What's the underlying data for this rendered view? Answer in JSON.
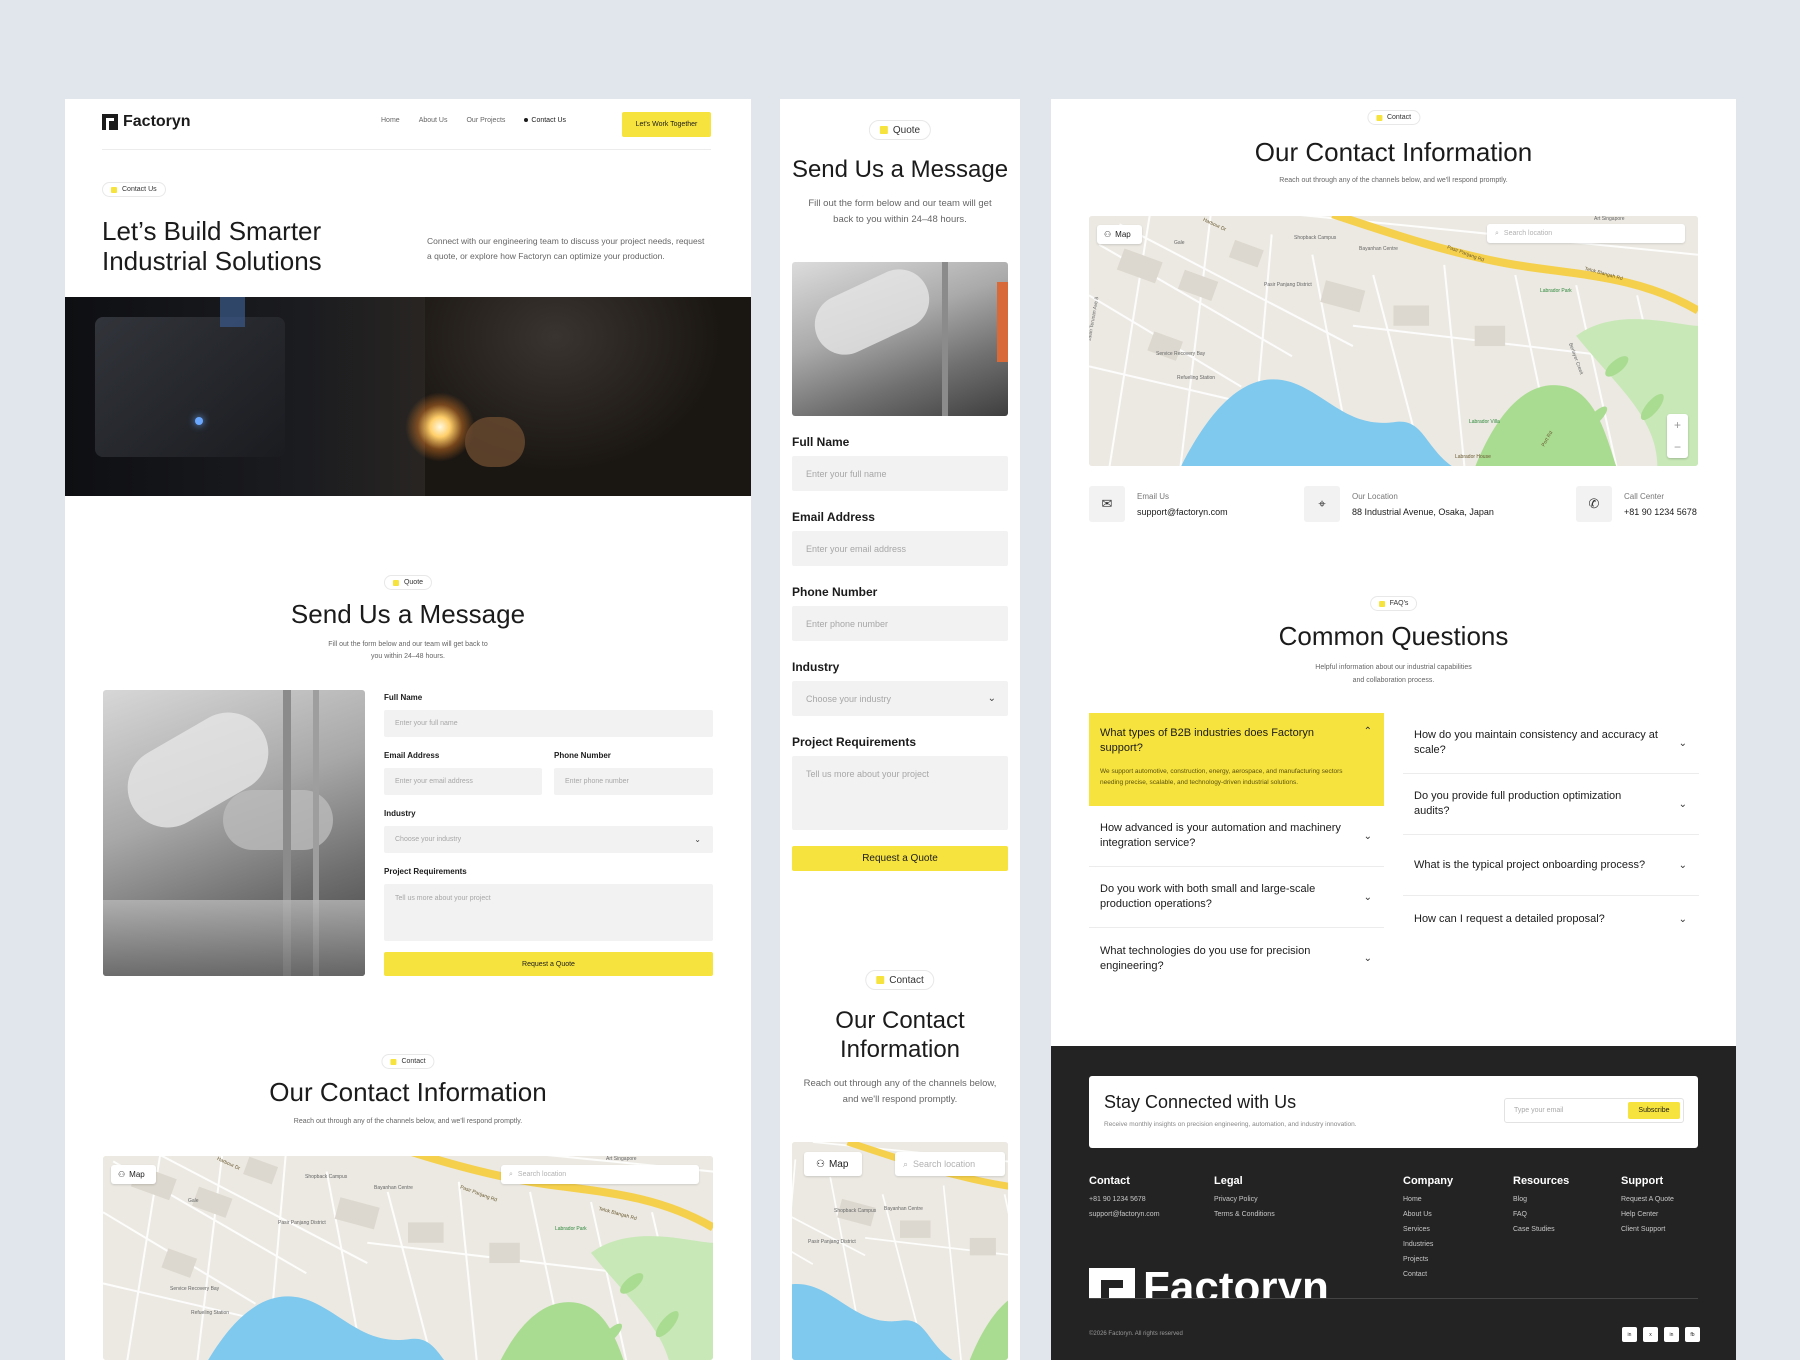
{
  "brand": "Factoryn",
  "nav": {
    "items": [
      "Home",
      "About Us",
      "Our Projects",
      "Contact Us"
    ],
    "active": "Contact Us",
    "cta": "Let's Work Together"
  },
  "hero": {
    "tag": "Contact Us",
    "title_line1": "Let’s Build Smarter",
    "title_line2": "Industrial Solutions",
    "description": "Connect with our engineering team to discuss your project needs, request a quote, or explore how Factoryn can optimize your production."
  },
  "quote": {
    "tag": "Quote",
    "title": "Send Us a Message",
    "subtitle_line1": "Fill out the form below and our team will get back to",
    "subtitle_line2": "you within 24–48 hours.",
    "mobile_subtitle_line1": "Fill out the form below and our team will get",
    "mobile_subtitle_line2": "back to you within 24–48 hours.",
    "fields": {
      "full_name_label": "Full Name",
      "full_name_placeholder": "Enter your full name",
      "email_label": "Email Address",
      "email_placeholder": "Enter your email address",
      "phone_label": "Phone Number",
      "phone_placeholder": "Enter phone number",
      "industry_label": "Industry",
      "industry_placeholder": "Choose your industry",
      "requirements_label": "Project Requirements",
      "requirements_placeholder": "Tell us more about your project"
    },
    "submit": "Request a Quote"
  },
  "contact": {
    "tag": "Contact",
    "title": "Our Contact Information",
    "mobile_title_line1": "Our Contact",
    "mobile_title_line2": "Information",
    "subtitle": "Reach out through any of the channels below, and we'll respond promptly.",
    "mobile_subtitle_line1": "Reach out through any of the channels below,",
    "mobile_subtitle_line2": "and we'll respond promptly.",
    "map_button": "Map",
    "map_search": "Search location",
    "map_labels": {
      "harbour": "Harbour Dr",
      "shopback": "Shopback Campus",
      "bayanhan": "Bayanhan Centre",
      "pasir": "Pasir Panjang Rd",
      "telok": "Telok Blangah Rd",
      "labrador": "Labrador Park",
      "district": "Pasir Panjang District",
      "service": "Service Recovery Bay",
      "refuel": "Refueling Station",
      "art": "Art Singapore",
      "villa": "Labrador Villa",
      "house": "Labrador House",
      "gale": "Gale",
      "port": "Port Rd",
      "berlayer": "Berlayer Creek",
      "jalan": "Jalan Terusan Ave 8"
    },
    "channels": [
      {
        "label": "Email Us",
        "value": "support@factoryn.com",
        "icon": "mail-icon"
      },
      {
        "label": "Our Location",
        "value": "88 Industrial Avenue, Osaka, Japan",
        "icon": "location-pin-icon"
      },
      {
        "label": "Call Center",
        "value": "+81 90 1234 5678",
        "icon": "phone-icon"
      }
    ]
  },
  "faq": {
    "tag": "FAQ's",
    "title": "Common Questions",
    "subtitle_line1": "Helpful information about our industrial capabilities",
    "subtitle_line2": "and collaboration process.",
    "left": [
      {
        "q": "What types of B2B industries does Factoryn support?",
        "a": "We support automotive, construction, energy, aerospace, and manufacturing sectors needing precise, scalable, and technology-driven industrial solutions.",
        "open": true
      },
      {
        "q": "How advanced is your automation and machinery integration service?"
      },
      {
        "q": "Do you work with both small and large-scale production operations?"
      },
      {
        "q": "What technologies do you use for precision engineering?"
      }
    ],
    "right": [
      {
        "q": "How do you maintain consistency and accuracy at scale?"
      },
      {
        "q": "Do you provide full production optimization audits?"
      },
      {
        "q": "What is the typical project onboarding process?"
      },
      {
        "q": "How can I request a detailed proposal?"
      }
    ]
  },
  "footer": {
    "newsletter_title": "Stay Connected with Us",
    "newsletter_sub": "Receive monthly insights on precision engineering, automation, and industry innovation.",
    "email_placeholder": "Type your email",
    "subscribe": "Subscribe",
    "columns": {
      "contact": {
        "title": "Contact",
        "items": [
          "+81 90 1234 5678",
          "support@factoryn.com"
        ]
      },
      "legal": {
        "title": "Legal",
        "items": [
          "Privacy Policy",
          "Terms & Conditions"
        ]
      },
      "company": {
        "title": "Company",
        "items": [
          "Home",
          "About Us",
          "Services",
          "Industries",
          "Projects",
          "Contact"
        ]
      },
      "resources": {
        "title": "Resources",
        "items": [
          "Blog",
          "FAQ",
          "Case Studies"
        ]
      },
      "support": {
        "title": "Support",
        "items": [
          "Request A Quote",
          "Help Center",
          "Client Support"
        ]
      }
    },
    "brand_large": "Factoryn",
    "copyright": "©2026 Factoryn. All rights reserved",
    "socials": [
      "in",
      "x",
      "in",
      "fb"
    ]
  },
  "colors": {
    "accent": "#f7e33e",
    "footer_bg": "#232323",
    "page_bg": "#e1e5ec",
    "map_water": "#7fc8ee",
    "map_park": "#a9dc91",
    "map_road": "#f5d04d"
  }
}
